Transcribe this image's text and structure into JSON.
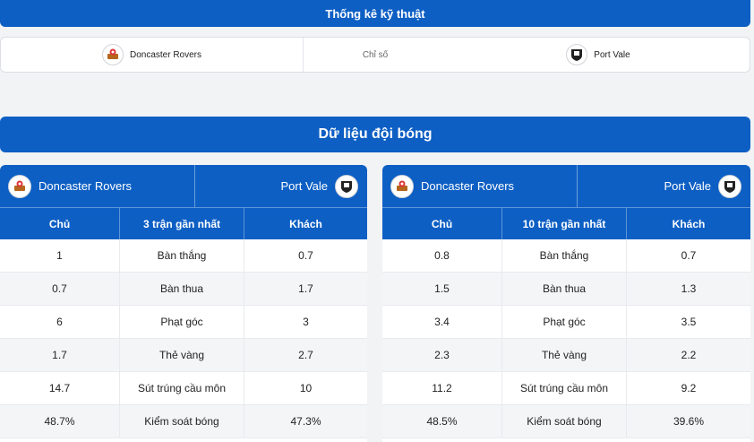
{
  "header": {
    "title": "Thống kê kỹ thuật"
  },
  "stats_row": {
    "home": "Doncaster Rovers",
    "middle": "Chỉ số",
    "away": "Port Vale"
  },
  "section": {
    "title": "Dữ liệu đội bóng"
  },
  "panels": [
    {
      "home_team": "Doncaster Rovers",
      "away_team": "Port Vale",
      "columns": [
        "Chủ",
        "3 trận gần nhất",
        "Khách"
      ],
      "rows": [
        {
          "home": "1",
          "label": "Bàn thắng",
          "away": "0.7"
        },
        {
          "home": "0.7",
          "label": "Bàn thua",
          "away": "1.7"
        },
        {
          "home": "6",
          "label": "Phạt góc",
          "away": "3"
        },
        {
          "home": "1.7",
          "label": "Thẻ vàng",
          "away": "2.7"
        },
        {
          "home": "14.7",
          "label": "Sút trúng cầu môn",
          "away": "10"
        },
        {
          "home": "48.7%",
          "label": "Kiểm soát bóng",
          "away": "47.3%"
        }
      ]
    },
    {
      "home_team": "Doncaster Rovers",
      "away_team": "Port Vale",
      "columns": [
        "Chủ",
        "10 trận gần nhất",
        "Khách"
      ],
      "rows": [
        {
          "home": "0.8",
          "label": "Bàn thắng",
          "away": "0.7"
        },
        {
          "home": "1.5",
          "label": "Bàn thua",
          "away": "1.3"
        },
        {
          "home": "3.4",
          "label": "Phạt góc",
          "away": "3.5"
        },
        {
          "home": "2.3",
          "label": "Thẻ vàng",
          "away": "2.2"
        },
        {
          "home": "11.2",
          "label": "Sút trúng cầu môn",
          "away": "9.2"
        },
        {
          "home": "48.5%",
          "label": "Kiểm soát bóng",
          "away": "39.6%"
        }
      ]
    }
  ],
  "colors": {
    "primary": "#0d5fc4",
    "background": "#f2f3f5"
  },
  "icons": {
    "home_crest": "doncaster-crest-icon",
    "away_crest": "port-vale-crest-icon"
  }
}
